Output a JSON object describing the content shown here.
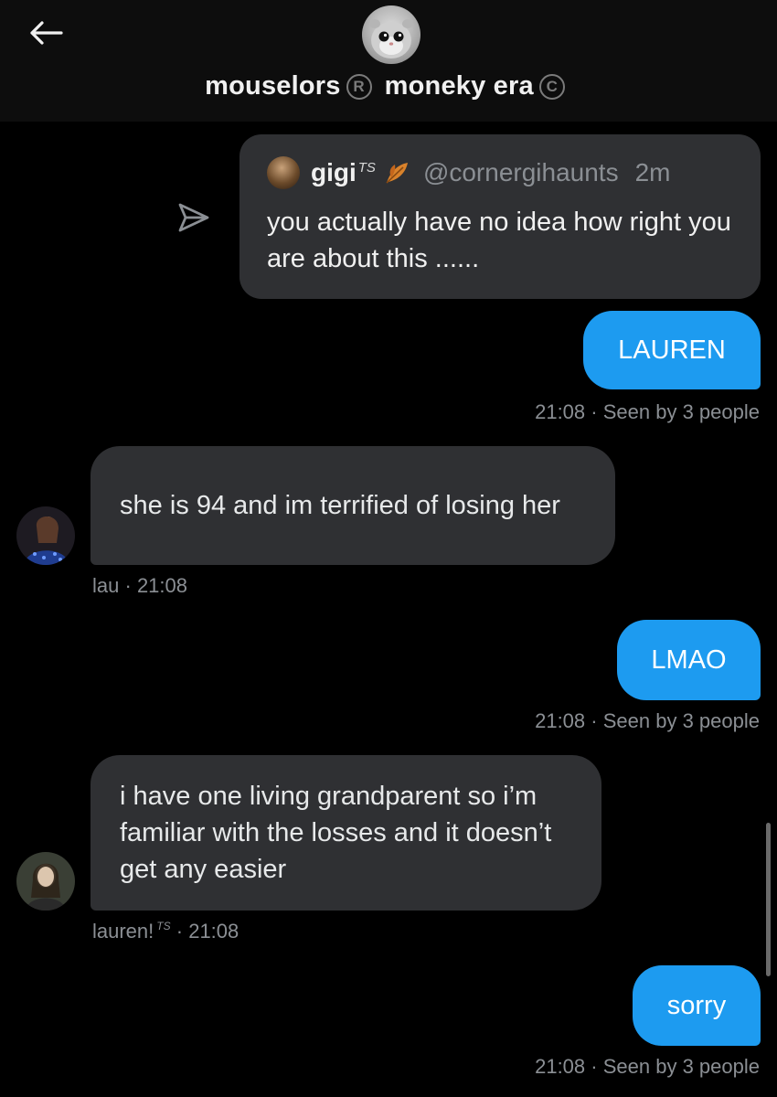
{
  "header": {
    "back_icon": "arrow-left-icon",
    "avatar_icon": "hamster-avatar",
    "title_part1": "mouselors",
    "mark1": "R",
    "title_part2": "moneky era",
    "mark2": "C"
  },
  "quote": {
    "avatar_icon": "user-avatar",
    "name": "gigi",
    "name_badge": "TS",
    "leaf_icon": "autumn-leaf-emoji",
    "handle": "@cornergihaunts",
    "time": "2m",
    "text": "you actually have no idea how right you are about this ......",
    "share_icon": "share-arrow-icon"
  },
  "messages": [
    {
      "direction": "out",
      "text": "LAUREN",
      "time": "21:08",
      "seen": "Seen by 3 people"
    },
    {
      "direction": "in",
      "text": "she is 94 and im terrified of losing her",
      "sender": "lau",
      "time": "21:08"
    },
    {
      "direction": "out",
      "text": "LMAO",
      "time": "21:08",
      "seen": "Seen by 3 people"
    },
    {
      "direction": "in",
      "text": "i have one living grandparent so i’m familiar with the losses and it doesn’t get any easier",
      "sender": "lauren!",
      "sender_badge": "TS",
      "time": "21:08"
    },
    {
      "direction": "out",
      "text": "sorry",
      "time": "21:08",
      "seen": "Seen by 3 people"
    }
  ],
  "colors": {
    "background": "#000000",
    "header_bg": "#0d0d0d",
    "bubble_out": "#1d9bf0",
    "bubble_in": "#2f3033",
    "meta_text": "#8b8f94"
  }
}
